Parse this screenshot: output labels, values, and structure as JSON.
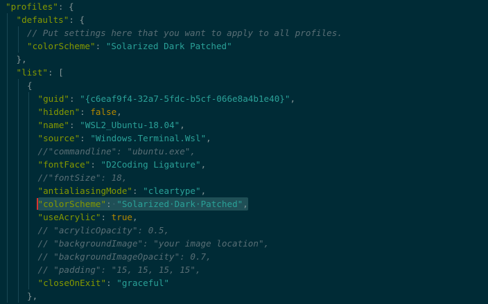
{
  "colors": {
    "background": "#002b36",
    "key": "#859900",
    "string": "#2aa198",
    "punct": "#839496",
    "keyword": "#b58900",
    "comment": "#586e75",
    "guide": "#1a4855",
    "selection": "#1f4f56",
    "cursor": "#dc322f"
  },
  "code_lines": [
    {
      "indent": 0,
      "tokens": [
        {
          "t": "\"profiles\"",
          "c": "key"
        },
        {
          "t": ": {",
          "c": "punct"
        }
      ]
    },
    {
      "indent": 1,
      "tokens": [
        {
          "t": "\"defaults\"",
          "c": "key"
        },
        {
          "t": ": {",
          "c": "punct"
        }
      ]
    },
    {
      "indent": 2,
      "tokens": [
        {
          "t": "// Put settings here that you want to apply to all profiles.",
          "c": "comment"
        }
      ]
    },
    {
      "indent": 2,
      "tokens": [
        {
          "t": "\"colorScheme\"",
          "c": "key"
        },
        {
          "t": ": ",
          "c": "punct"
        },
        {
          "t": "\"Solarized Dark Patched\"",
          "c": "string"
        }
      ]
    },
    {
      "indent": 1,
      "tokens": [
        {
          "t": "},",
          "c": "punct"
        }
      ]
    },
    {
      "indent": 1,
      "tokens": [
        {
          "t": "\"list\"",
          "c": "key"
        },
        {
          "t": ": [",
          "c": "punct"
        }
      ]
    },
    {
      "indent": 2,
      "tokens": [
        {
          "t": "{",
          "c": "punct"
        }
      ]
    },
    {
      "indent": 3,
      "tokens": [
        {
          "t": "\"guid\"",
          "c": "key"
        },
        {
          "t": ": ",
          "c": "punct"
        },
        {
          "t": "\"{c6eaf9f4-32a7-5fdc-b5cf-066e8a4b1e40}\"",
          "c": "string"
        },
        {
          "t": ",",
          "c": "punct"
        }
      ]
    },
    {
      "indent": 3,
      "tokens": [
        {
          "t": "\"hidden\"",
          "c": "key"
        },
        {
          "t": ": ",
          "c": "punct"
        },
        {
          "t": "false",
          "c": "keyword"
        },
        {
          "t": ",",
          "c": "punct"
        }
      ]
    },
    {
      "indent": 3,
      "tokens": [
        {
          "t": "\"name\"",
          "c": "key"
        },
        {
          "t": ": ",
          "c": "punct"
        },
        {
          "t": "\"WSL2_Ubuntu-18.04\"",
          "c": "string"
        },
        {
          "t": ",",
          "c": "punct"
        }
      ]
    },
    {
      "indent": 3,
      "tokens": [
        {
          "t": "\"source\"",
          "c": "key"
        },
        {
          "t": ": ",
          "c": "punct"
        },
        {
          "t": "\"Windows.Terminal.Wsl\"",
          "c": "string"
        },
        {
          "t": ",",
          "c": "punct"
        }
      ]
    },
    {
      "indent": 3,
      "tokens": [
        {
          "t": "//\"commandline\": \"ubuntu.exe\",",
          "c": "comment"
        }
      ]
    },
    {
      "indent": 3,
      "tokens": [
        {
          "t": "\"fontFace\"",
          "c": "key"
        },
        {
          "t": ": ",
          "c": "punct"
        },
        {
          "t": "\"D2Coding Ligature\"",
          "c": "string"
        },
        {
          "t": ",",
          "c": "punct"
        }
      ]
    },
    {
      "indent": 3,
      "tokens": [
        {
          "t": "//\"fontSize\": 18,",
          "c": "comment"
        }
      ]
    },
    {
      "indent": 3,
      "tokens": [
        {
          "t": "\"antialiasingMode\"",
          "c": "key"
        },
        {
          "t": ": ",
          "c": "punct"
        },
        {
          "t": "\"cleartype\"",
          "c": "string"
        },
        {
          "t": ",",
          "c": "punct"
        }
      ]
    },
    {
      "indent": 3,
      "selected": true,
      "tokens": [
        {
          "t": "\"colorScheme\"",
          "c": "key"
        },
        {
          "t": ":",
          "c": "punct"
        },
        {
          "t": "·",
          "c": "ws"
        },
        {
          "t": "\"Solarized·Dark·Patched\"",
          "c": "string"
        },
        {
          "t": ",",
          "c": "punct"
        }
      ]
    },
    {
      "indent": 3,
      "tokens": [
        {
          "t": "\"useAcrylic\"",
          "c": "key"
        },
        {
          "t": ": ",
          "c": "punct"
        },
        {
          "t": "true",
          "c": "keyword"
        },
        {
          "t": ",",
          "c": "punct"
        }
      ]
    },
    {
      "indent": 3,
      "tokens": [
        {
          "t": "// \"acrylicOpacity\": 0.5,",
          "c": "comment"
        }
      ]
    },
    {
      "indent": 3,
      "tokens": [
        {
          "t": "// \"backgroundImage\": \"your image location\",",
          "c": "comment"
        }
      ]
    },
    {
      "indent": 3,
      "tokens": [
        {
          "t": "// \"backgroundImageOpacity\": 0.7,",
          "c": "comment"
        }
      ]
    },
    {
      "indent": 3,
      "tokens": [
        {
          "t": "// \"padding\": \"15, 15, 15, 15\",",
          "c": "comment"
        }
      ]
    },
    {
      "indent": 3,
      "tokens": [
        {
          "t": "\"closeOnExit\"",
          "c": "key"
        },
        {
          "t": ": ",
          "c": "punct"
        },
        {
          "t": "\"graceful\"",
          "c": "string"
        }
      ]
    },
    {
      "indent": 2,
      "tokens": [
        {
          "t": "},",
          "c": "punct"
        }
      ]
    }
  ]
}
